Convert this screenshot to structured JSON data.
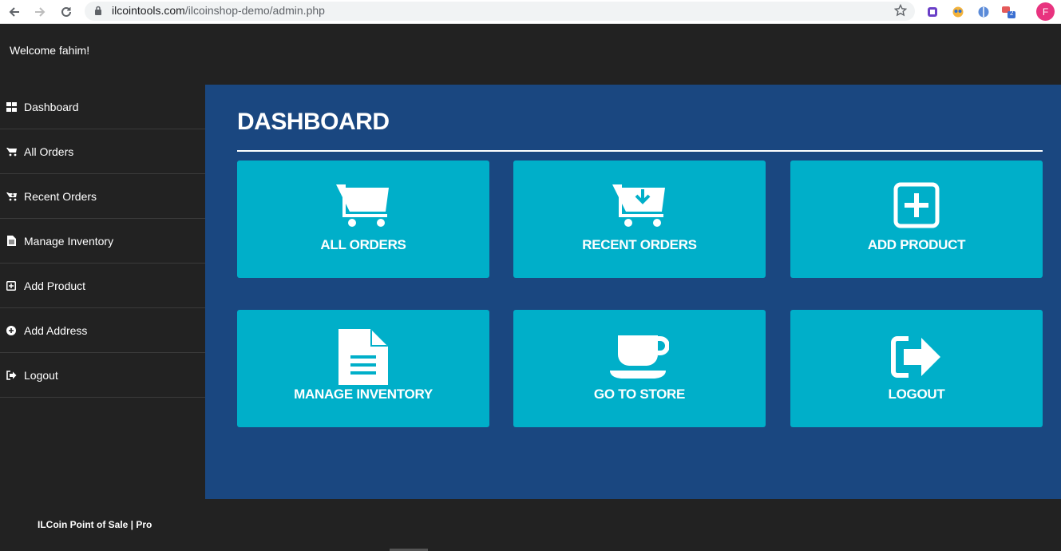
{
  "browser": {
    "url_host": "ilcointools.com",
    "url_path": "/ilcoinshop-demo/admin.php",
    "profile_initial": "F",
    "ext_badge": "2"
  },
  "header": {
    "welcome": "Welcome fahim!"
  },
  "sidebar": {
    "items": [
      {
        "label": "Dashboard",
        "icon": "dashboard-grid-icon"
      },
      {
        "label": "All Orders",
        "icon": "cart-icon"
      },
      {
        "label": "Recent Orders",
        "icon": "cart-download-icon"
      },
      {
        "label": "Manage Inventory",
        "icon": "document-icon"
      },
      {
        "label": "Add Product",
        "icon": "plus-square-icon"
      },
      {
        "label": "Add Address",
        "icon": "plus-circle-icon"
      },
      {
        "label": "Logout",
        "icon": "logout-icon"
      }
    ]
  },
  "main": {
    "title": "DASHBOARD",
    "tiles": [
      {
        "label": "ALL ORDERS",
        "icon": "cart-icon"
      },
      {
        "label": "RECENT ORDERS",
        "icon": "cart-download-icon"
      },
      {
        "label": "ADD PRODUCT",
        "icon": "plus-square-icon"
      },
      {
        "label": "MANAGE INVENTORY",
        "icon": "document-icon"
      },
      {
        "label": "GO TO STORE",
        "icon": "coffee-cup-icon"
      },
      {
        "label": "LOGOUT",
        "icon": "logout-icon"
      }
    ]
  },
  "footer": {
    "text": "ILCoin Point of Sale | Pro"
  },
  "colors": {
    "page_bg": "#222222",
    "main_bg": "#1a4780",
    "tile_bg": "#00afc9"
  }
}
